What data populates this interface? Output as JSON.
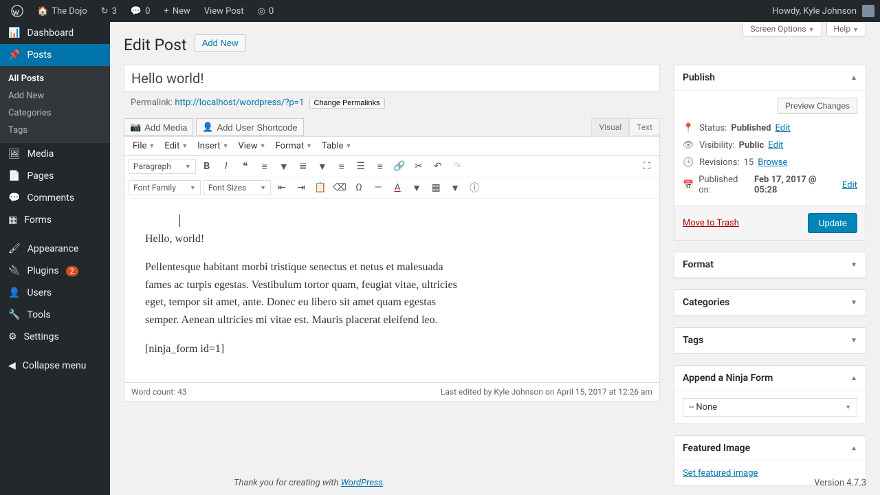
{
  "topbar": {
    "site": "The Dojo",
    "refresh": "3",
    "comments": "0",
    "new": "New",
    "viewpost": "View Post",
    "nf": "0",
    "howdy": "Howdy, Kyle Johnson"
  },
  "sidebar": {
    "dashboard": "Dashboard",
    "posts": "Posts",
    "sub": {
      "all": "All Posts",
      "add": "Add New",
      "cat": "Categories",
      "tags": "Tags"
    },
    "media": "Media",
    "pages": "Pages",
    "comments": "Comments",
    "forms": "Forms",
    "appearance": "Appearance",
    "plugins": "Plugins",
    "plugins_badge": "2",
    "users": "Users",
    "tools": "Tools",
    "settings": "Settings",
    "collapse": "Collapse menu"
  },
  "screen": {
    "opts": "Screen Options",
    "help": "Help"
  },
  "page": {
    "title": "Edit Post",
    "addnew": "Add New"
  },
  "post": {
    "title": "Hello world!",
    "permalink_label": "Permalink:",
    "permalink": "http://localhost/wordpress/?p=1",
    "change": "Change Permalinks",
    "addmedia": "Add Media",
    "addshort": "Add User Shortcode",
    "tabs": {
      "visual": "Visual",
      "text": "Text"
    }
  },
  "menubar": {
    "file": "File",
    "edit": "Edit",
    "insert": "Insert",
    "view": "View",
    "format": "Format",
    "table": "Table"
  },
  "toolbar": {
    "paragraph": "Paragraph",
    "fontfamily": "Font Family",
    "fontsizes": "Font Sizes"
  },
  "body": {
    "p1": "Hello, world!",
    "p2": "Pellentesque habitant morbi tristique senectus et netus et malesuada fames ac turpis egestas. Vestibulum tortor quam, feugiat vitae, ultricies eget, tempor sit amet, ante. Donec eu libero sit amet quam egestas semper. Aenean ultricies mi vitae est. Mauris placerat eleifend leo.",
    "p3": "[ninja_form id=1]"
  },
  "footer": {
    "wc_label": "Word count: ",
    "wc": "43",
    "lastedit": "Last edited by Kyle Johnson on April 15, 2017 at 12:26 am"
  },
  "publish": {
    "title": "Publish",
    "preview": "Preview Changes",
    "status_l": "Status:",
    "status": "Published",
    "edit": "Edit",
    "vis_l": "Visibility:",
    "vis": "Public",
    "rev_l": "Revisions:",
    "rev": "15",
    "browse": "Browse",
    "pub_l": "Published on:",
    "pub": "Feb 17, 2017 @ 05:28",
    "trash": "Move to Trash",
    "update": "Update"
  },
  "boxes": {
    "format": "Format",
    "categories": "Categories",
    "tags": "Tags",
    "ninja": "Append a Ninja Form",
    "ninja_sel": "-- None",
    "featured": "Featured Image",
    "featured_link": "Set featured image"
  },
  "wpfooter": {
    "thank": "Thank you for creating with ",
    "wp": "WordPress",
    "dot": ".",
    "ver": "Version 4.7.3"
  }
}
